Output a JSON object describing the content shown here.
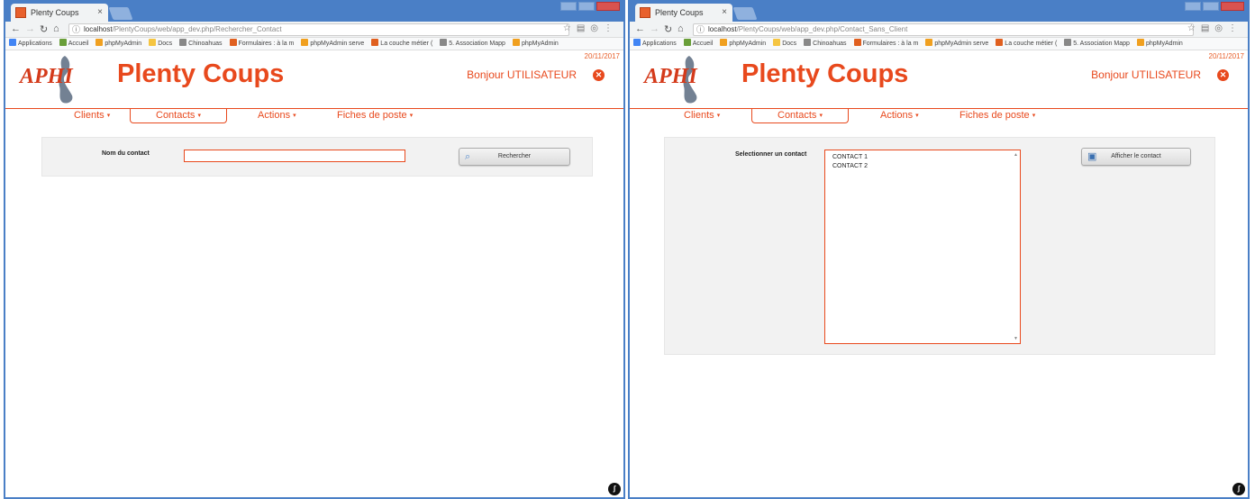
{
  "colors": {
    "accent": "#e8491d",
    "chrome_frame": "#4a7fc6",
    "panel_bg": "#f2f2f2"
  },
  "browser": {
    "tab_title": "Plenty Coups",
    "tab_close": "×",
    "bookmarks": [
      {
        "label": "Applications",
        "icon": "apps-grid-icon"
      },
      {
        "label": "Accueil",
        "icon": "image-icon"
      },
      {
        "label": "phpMyAdmin",
        "icon": "phpmyadmin-icon"
      },
      {
        "label": "Docs",
        "icon": "folder-icon"
      },
      {
        "label": "Chinoahuas",
        "icon": "page-icon"
      },
      {
        "label": "Formulaires : à la m",
        "icon": "web-icon"
      },
      {
        "label": "phpMyAdmin serve",
        "icon": "phpmyadmin-icon"
      },
      {
        "label": "La couche métier ( ",
        "icon": "web-icon"
      },
      {
        "label": "5. Association Mapp",
        "icon": "page-icon"
      },
      {
        "label": "phpMyAdmin",
        "icon": "phpmyadmin-icon"
      }
    ]
  },
  "app": {
    "title": "Plenty Coups",
    "logo_text": "APHI",
    "greeting": "Bonjour UTILISATEUR",
    "logout_icon": "close-circle-icon",
    "date": "20/11/2017",
    "menu": [
      "Clients",
      "Contacts",
      "Actions",
      "Fiches de poste"
    ],
    "active_menu": "Contacts"
  },
  "left": {
    "url_host": "localhost",
    "url_path": "/PlentyCoups/web/app_dev.php/Rechercher_Contact",
    "search_label": "Nom du contact",
    "search_value": "",
    "search_button": "Rechercher",
    "search_button_icon": "magnifier-icon"
  },
  "right": {
    "url_host": "localhost",
    "url_path": "/PlentyCoups/web/app_dev.php/Contact_Sans_Client",
    "select_label": "Selectionner un contact",
    "contacts": [
      "CONTACT 1",
      "CONTACT 2"
    ],
    "show_button": "Afficher le contact",
    "show_button_icon": "computer-icon"
  }
}
